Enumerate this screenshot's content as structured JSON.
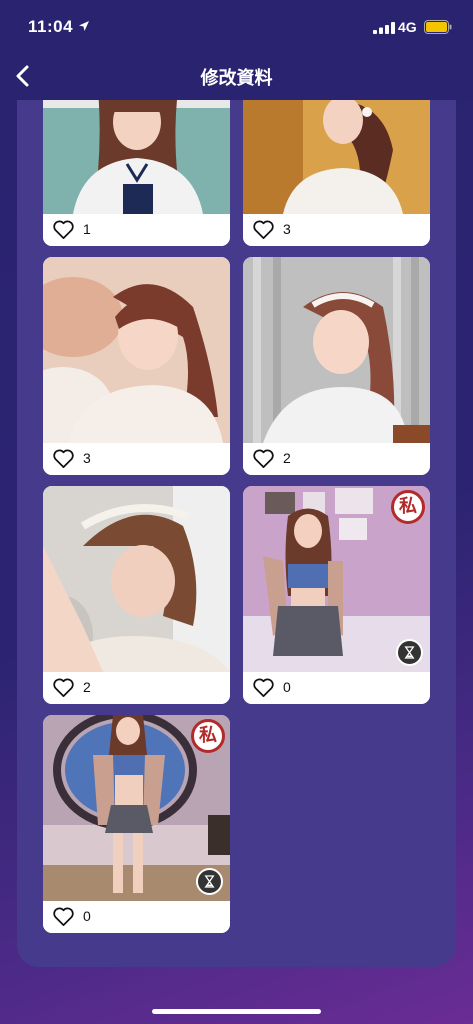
{
  "status": {
    "time": "11:04",
    "network": "4G",
    "battery_color": "#f5c400"
  },
  "nav": {
    "title": "修改資料",
    "back_icon": "chevron-left-icon"
  },
  "photos": [
    {
      "likes": "1",
      "private": false,
      "pending": false
    },
    {
      "likes": "3",
      "private": false,
      "pending": false
    },
    {
      "likes": "3",
      "private": false,
      "pending": false
    },
    {
      "likes": "2",
      "private": false,
      "pending": false
    },
    {
      "likes": "2",
      "private": false,
      "pending": false
    },
    {
      "likes": "0",
      "private": true,
      "pending": true,
      "badge": "私"
    },
    {
      "likes": "0",
      "private": true,
      "pending": true,
      "badge": "私"
    }
  ],
  "colors": {
    "background": "#2a2470",
    "panel": "#453a8c",
    "card": "#ffffff",
    "badge_red": "#b22a2a"
  }
}
